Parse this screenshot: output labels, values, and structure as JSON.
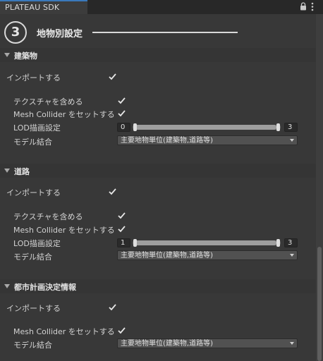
{
  "window": {
    "tab_title": "PLATEAU SDK",
    "lock_icon": "lock-icon",
    "menu_icon": "kebab-menu-icon"
  },
  "step": {
    "number": "3",
    "title": "地物別設定"
  },
  "sections": [
    {
      "title": "建築物",
      "import_label": "インポートする",
      "import_checked": true,
      "texture_label": "テクスチャを含める",
      "texture_checked": true,
      "mesh_label": "Mesh Collider をセットする",
      "mesh_checked": true,
      "lod_label": "LOD描画設定",
      "lod_min": "0",
      "lod_max": "3",
      "merge_label": "モデル結合",
      "merge_value": "主要地物単位(建築物,道路等)"
    },
    {
      "title": "道路",
      "import_label": "インポートする",
      "import_checked": true,
      "texture_label": "テクスチャを含める",
      "texture_checked": true,
      "mesh_label": "Mesh Collider をセットする",
      "mesh_checked": true,
      "lod_label": "LOD描画設定",
      "lod_min": "1",
      "lod_max": "3",
      "merge_label": "モデル結合",
      "merge_value": "主要地物単位(建築物,道路等)"
    },
    {
      "title": "都市計画決定情報",
      "import_label": "インポートする",
      "import_checked": true,
      "mesh_label": "Mesh Collider をセットする",
      "mesh_checked": true,
      "merge_label": "モデル結合",
      "merge_value": "主要地物単位(建築物,道路等)"
    }
  ],
  "colors": {
    "background": "#383838",
    "tab_accent": "#3a79bb",
    "text": "#d2d2d2"
  }
}
